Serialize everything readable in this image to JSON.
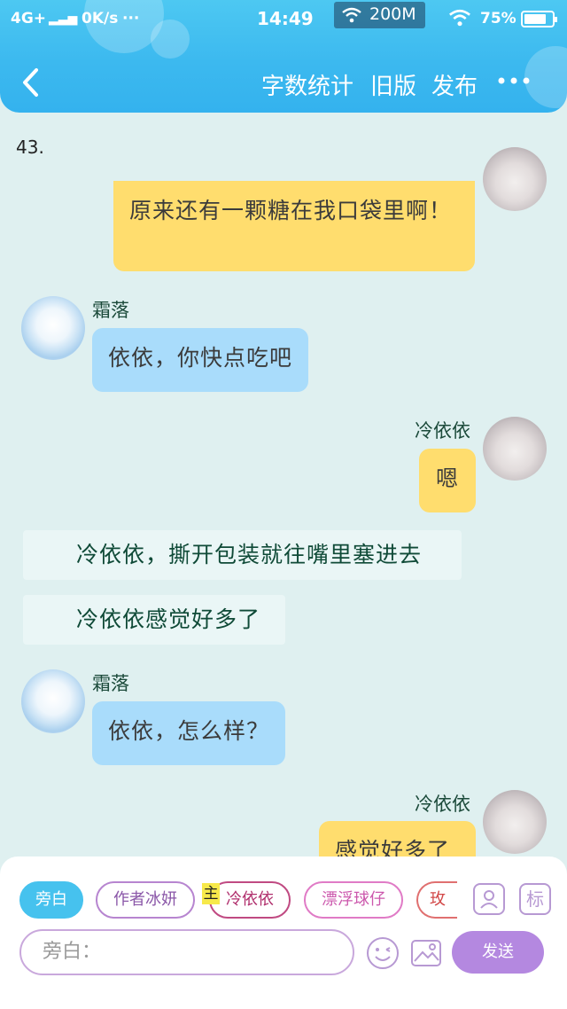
{
  "status_bar": {
    "network": "4G+",
    "speed": "0K/s",
    "dots": "···",
    "time": "14:49",
    "data_badge": "200M",
    "battery": "75%"
  },
  "nav": {
    "word_count": "字数统计",
    "old_version": "旧版",
    "publish": "发布"
  },
  "chat": {
    "chapter": "43.",
    "messages": [
      {
        "type": "right",
        "sender": "",
        "text": "原来还有一颗糖在我口袋里啊！"
      },
      {
        "type": "left",
        "sender": "霜落",
        "text": "依依，你快点吃吧"
      },
      {
        "type": "right",
        "sender": "冷依依",
        "text": "嗯"
      },
      {
        "type": "narration",
        "text": "冷依依，撕开包装就往嘴里塞进去"
      },
      {
        "type": "narration",
        "text": "冷依依感觉好多了"
      },
      {
        "type": "left",
        "sender": "霜落",
        "text": "依依，怎么样？"
      },
      {
        "type": "right",
        "sender": "冷依依",
        "text": "感觉好多了"
      }
    ]
  },
  "panel": {
    "roles": [
      "旁白",
      "作者冰妍",
      "冷依依",
      "漂浮球仔",
      "玫"
    ],
    "main_badge": "主",
    "tag_icon_text": "标",
    "input_placeholder": "旁白：",
    "send": "发送"
  },
  "colors": {
    "header": "#3cb9ef",
    "yellow_bubble": "#ffdd6e",
    "blue_bubble": "#a9dcfb",
    "background": "#dff0f0",
    "send_button": "#b488e0"
  }
}
